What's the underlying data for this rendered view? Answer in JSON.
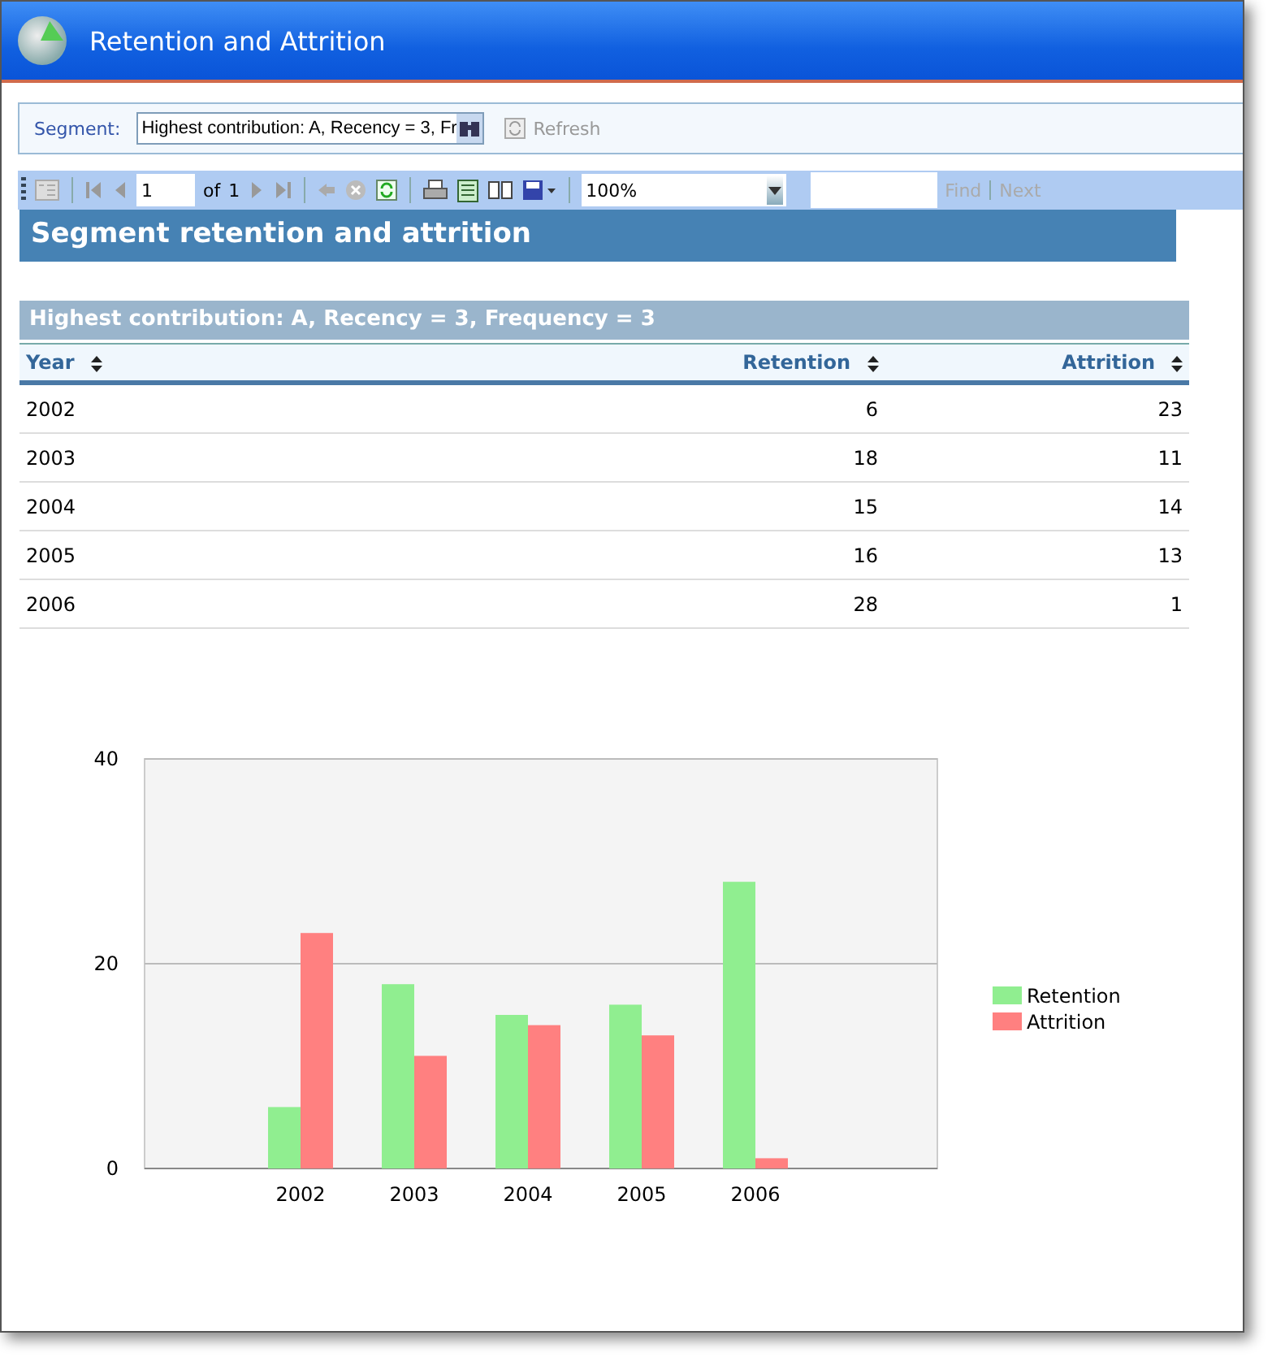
{
  "window": {
    "title": "Retention and Attrition"
  },
  "parameters": {
    "segment_label": "Segment:",
    "segment_value": "Highest contribution: A, Recency = 3, Fr",
    "refresh": {
      "label": "Refresh",
      "disabled": true
    }
  },
  "toolbar": {
    "page": "1",
    "of_label": "of",
    "page_count": "1",
    "zoom": "100%",
    "find": {
      "label": "Find",
      "disabled": true
    },
    "next": {
      "label": "Next",
      "disabled": true
    }
  },
  "report": {
    "title": "Segment retention and attrition",
    "group_title": "Highest contribution: A, Recency = 3, Frequency = 3",
    "table": {
      "columns": [
        "Year",
        "Retention",
        "Attrition"
      ],
      "rows": [
        [
          "2002",
          "6",
          "23"
        ],
        [
          "2003",
          "18",
          "11"
        ],
        [
          "2004",
          "15",
          "14"
        ],
        [
          "2005",
          "16",
          "13"
        ],
        [
          "2006",
          "28",
          "1"
        ]
      ]
    },
    "chart_data": {
      "type": "bar",
      "categories": [
        "2002",
        "2003",
        "2004",
        "2005",
        "2006"
      ],
      "series": [
        {
          "name": "Retention",
          "color": "#90ee90",
          "values": [
            6,
            18,
            15,
            16,
            28
          ]
        },
        {
          "name": "Attrition",
          "color": "#ff8080",
          "values": [
            23,
            11,
            14,
            13,
            1
          ]
        }
      ],
      "legend": "right",
      "ylim": [
        0,
        40
      ],
      "yticks": [
        {
          "value": 0,
          "label": "0"
        },
        {
          "value": 20,
          "label": "20"
        },
        {
          "value": 40,
          "label": "40"
        }
      ]
    }
  }
}
